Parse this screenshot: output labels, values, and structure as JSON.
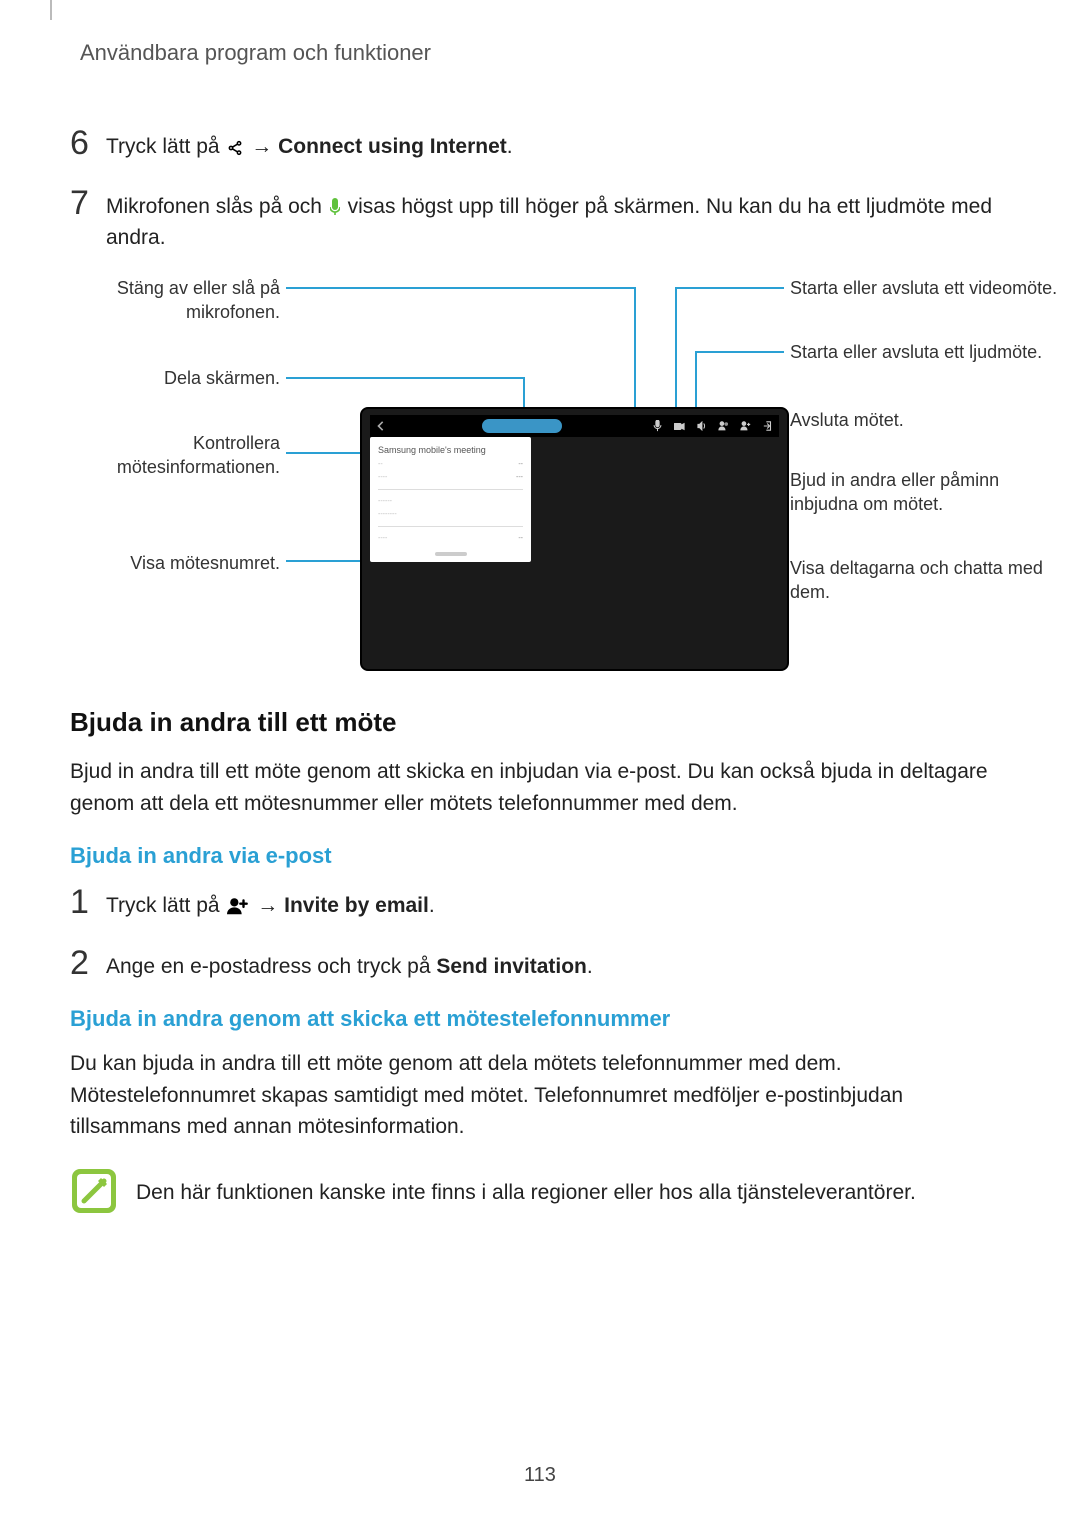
{
  "header": "Användbara program och funktioner",
  "step6": {
    "num": "6",
    "pre": "Tryck lätt på ",
    "arrow": " → ",
    "bold": "Connect using Internet",
    "post": "."
  },
  "step7": {
    "num": "7",
    "pre": "Mikrofonen slås på och ",
    "post": " visas högst upp till höger på skärmen. Nu kan du ha ett ljudmöte med andra."
  },
  "callouts": {
    "left": {
      "mic": "Stäng av eller slå på mikrofonen.",
      "share": "Dela skärmen.",
      "info": "Kontrollera mötesinformationen.",
      "number": "Visa mötesnumret."
    },
    "right": {
      "video": "Starta eller avsluta ett videomöte.",
      "audio": "Starta eller avsluta ett ljudmöte.",
      "end": "Avsluta mötet.",
      "invite": "Bjud in andra eller påminn inbjudna om mötet.",
      "participants": "Visa deltagarna och chatta med dem."
    }
  },
  "section2": {
    "heading": "Bjuda in andra till ett möte",
    "para": "Bjud in andra till ett möte genom att skicka en inbjudan via e-post. Du kan också bjuda in deltagare genom att dela ett mötesnummer eller mötets telefonnummer med dem.",
    "sub1": "Bjuda in andra via e-post",
    "step1": {
      "num": "1",
      "pre": "Tryck lätt på ",
      "arrow": " → ",
      "bold": "Invite by email",
      "post": "."
    },
    "step2": {
      "num": "2",
      "pre": "Ange en e-postadress och tryck på ",
      "bold": "Send invitation",
      "post": "."
    },
    "sub2": "Bjuda in andra genom att skicka ett mötestelefonnummer",
    "para2": "Du kan bjuda in andra till ett möte genom att dela mötets telefonnummer med dem. Mötestelefonnumret skapas samtidigt med mötet. Telefonnumret medföljer e-postinbjudan tillsammans med annan mötesinformation.",
    "note": "Den här funktionen kanske inte finns i alla regioner eller hos alla tjänsteleverantörer."
  },
  "page_num": "113"
}
